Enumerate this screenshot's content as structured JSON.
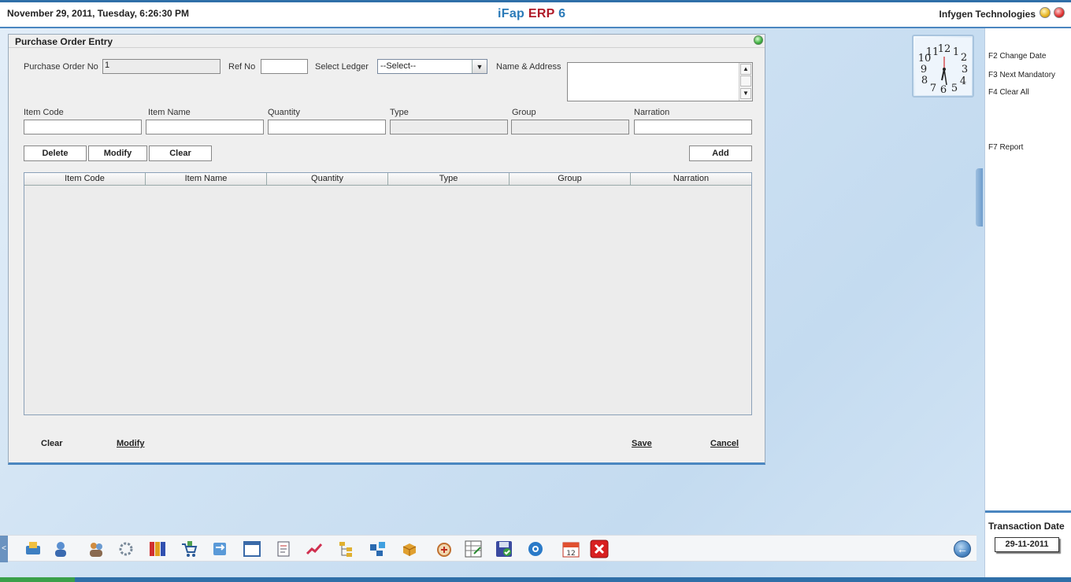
{
  "header": {
    "datetime": "November  29, 2011, Tuesday, 6:26:30 PM",
    "brand_ifap": "iFap",
    "brand_erp": "ERP",
    "brand_ver": "6",
    "company": "Infygen Technologies"
  },
  "form": {
    "title": "Purchase Order Entry",
    "po_no_label": "Purchase Order No",
    "po_no_value": "1",
    "ref_no_label": "Ref No",
    "ref_no_value": "",
    "ledger_label": "Select Ledger",
    "ledger_value": "--Select--",
    "address_label": "Name & Address",
    "item_code_label": "Item Code",
    "item_name_label": "Item Name",
    "quantity_label": "Quantity",
    "type_label": "Type",
    "group_label": "Group",
    "narration_label": "Narration",
    "buttons": {
      "delete": "Delete",
      "modify": "Modify",
      "clear": "Clear",
      "add": "Add"
    },
    "grid_columns": [
      "Item Code",
      "Item Name",
      "Quantity",
      "Type",
      "Group",
      "Narration"
    ],
    "footer": {
      "clear": "Clear",
      "modify": "Modify",
      "save": "Save",
      "cancel": "Cancel"
    }
  },
  "clock": {
    "time": "6:26:30"
  },
  "shortcuts": {
    "f2": "F2 Change Date",
    "f3": "F3 Next Mandatory",
    "f4": "F4 Clear All",
    "f7": "F7 Report"
  },
  "transaction": {
    "title": "Transaction Date",
    "date": "29-11-2011"
  },
  "toolbar": {
    "icons": [
      "sales-icon",
      "customer-icon",
      "users-icon",
      "network-icon",
      "books-icon",
      "cart-icon",
      "transfer-icon",
      "window-icon",
      "document-icon",
      "chart-icon",
      "tree-icon",
      "workflow-icon",
      "package-icon",
      "calculator-icon",
      "spreadsheet-icon",
      "save-disk-icon",
      "settings-icon",
      "calendar-icon",
      "close-icon"
    ],
    "calendar_day": "12",
    "back_glyph": "←"
  },
  "colors": {
    "accent": "#2f6fa8",
    "brand_blue": "#2a7ab8",
    "brand_red": "#b01a28"
  }
}
